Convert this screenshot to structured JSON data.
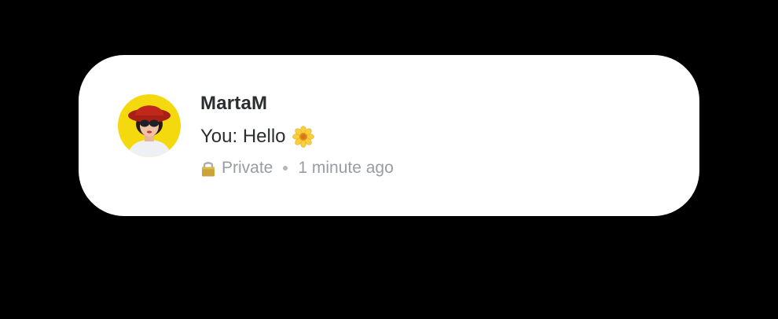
{
  "notification": {
    "sender_name": "MartaM",
    "message_text": "You: Hello",
    "message_emoji": "flower-icon",
    "privacy_icon": "lock-icon",
    "privacy_label": "Private",
    "timestamp": "1 minute ago"
  },
  "colors": {
    "background": "#000000",
    "card": "#ffffff",
    "name_text": "#2b2d31",
    "meta_text": "#9a9ca3",
    "avatar_bg": "#f5d90f",
    "hat": "#b52418"
  }
}
